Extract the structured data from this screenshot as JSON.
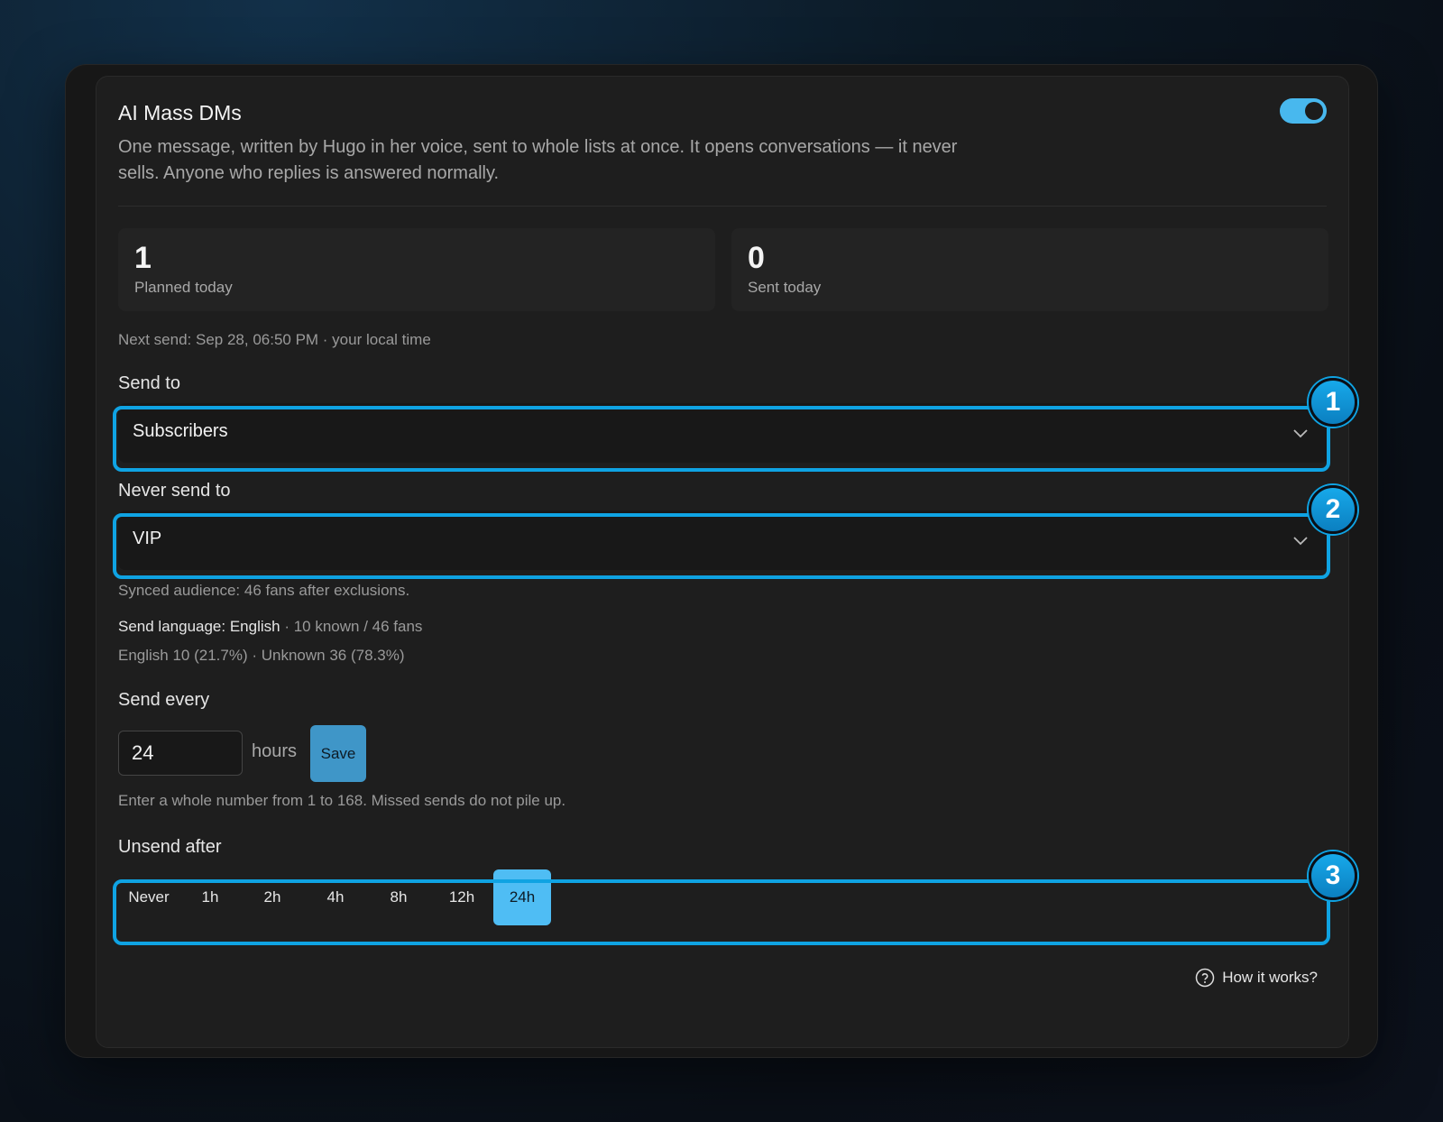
{
  "header": {
    "title": "AI Mass DMs",
    "description": "One message, written by Hugo in her voice, sent to whole lists at once. It opens conversations — it never sells. Anyone who replies is answered normally.",
    "enabled": true
  },
  "stats": [
    {
      "value": "1",
      "label": "Planned today"
    },
    {
      "value": "0",
      "label": "Sent today"
    }
  ],
  "next_send": "Next send: Sep 28, 06:50 PM · your local time",
  "send_to": {
    "label": "Send to",
    "value": "Subscribers"
  },
  "never_send_to": {
    "label": "Never send to",
    "value": "VIP"
  },
  "audience_note": "Synced audience: 46 fans after exclusions.",
  "language": {
    "label": "Send language: English",
    "detail": " · 10 known / 46 fans",
    "breakdown": "English 10 (21.7%) · Unknown 36 (78.3%)"
  },
  "send_every": {
    "label": "Send every",
    "value": "24",
    "unit": "hours",
    "save_label": "Save",
    "hint": "Enter a whole number from 1 to 168. Missed sends do not pile up."
  },
  "unsend_after": {
    "label": "Unsend after",
    "options": [
      "Never",
      "1h",
      "2h",
      "4h",
      "8h",
      "12h",
      "24h"
    ],
    "selected": "24h"
  },
  "help_link": "How it works?",
  "badges": [
    "1",
    "2",
    "3"
  ],
  "colors": {
    "accent": "#0fa3e3",
    "toggle": "#48b8ee",
    "selected": "#4fbdf4",
    "save": "#3f96c8"
  }
}
